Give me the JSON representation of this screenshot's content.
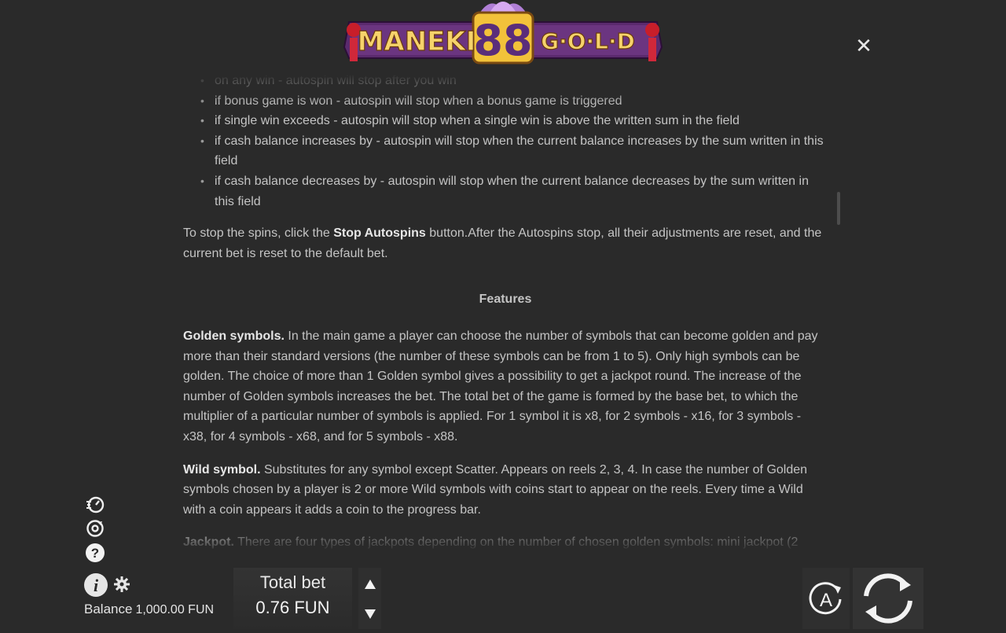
{
  "logo": {
    "text_left": "MANEKI",
    "text_number": "88",
    "text_right": "G·O·L·D"
  },
  "close_icon": "close-icon",
  "rules": {
    "autospin_conditions": [
      "on any win - autospin will stop after you win",
      "if bonus game is won - autospin will stop when a bonus game is triggered",
      "if single win exceeds - autospin will stop when a single win is above the written sum in the field",
      "if cash balance increases by - autospin will stop when the current balance increases by the sum written in this field",
      "if cash balance decreases by - autospin will stop when the current balance decreases by the sum written in this field"
    ],
    "stop_para": {
      "prefix": "To stop the spins, click the ",
      "bold": "Stop Autospins",
      "suffix": " button.After the Autospins stop, all their adjustments are reset, and the current bet is reset to the default bet."
    },
    "features_heading": "Features",
    "golden": {
      "bold": "Golden symbols.",
      "text": " In the main game a player can choose the number of symbols that can become golden and pay more than their standard versions (the number of these symbols can be from 1 to 5). Only high symbols can be golden. The choice of more than 1 Golden symbol gives a possibility to get a jackpot round. The increase of the number of Golden symbols increases the bet. The total bet of the game is formed by the base bet, to which the multiplier of a particular number of symbols is applied. For 1 symbol it is x8, for 2 symbols - x16, for 3 symbols - x38, for 4 symbols - x68, and for 5 symbols - x88."
    },
    "wild": {
      "bold": "Wild symbol.",
      "text": " Substitutes for any symbol except Scatter. Appears on reels 2, 3, 4. In case the number of Golden symbols chosen by a player is 2 or more Wild symbols with coins start to appear on the reels. Every time a Wild with a coin appears it adds a coin to the progress bar."
    },
    "jackpot": {
      "bold": "Jackpot.",
      "text": " There are four types of jackpots depending on the number of chosen golden symbols: mini jackpot (2"
    }
  },
  "bottom": {
    "total_bet_label": "Total bet",
    "total_bet_value": "0.76 FUN",
    "balance_label": "Balance",
    "balance_value": "1,000.00 FUN",
    "auto_label": "A"
  },
  "colors": {
    "background": "#2a2a2a",
    "text": "#c4c4c4",
    "accent_gold": "#f2c23a",
    "logo_purple": "#5b2a6e"
  }
}
